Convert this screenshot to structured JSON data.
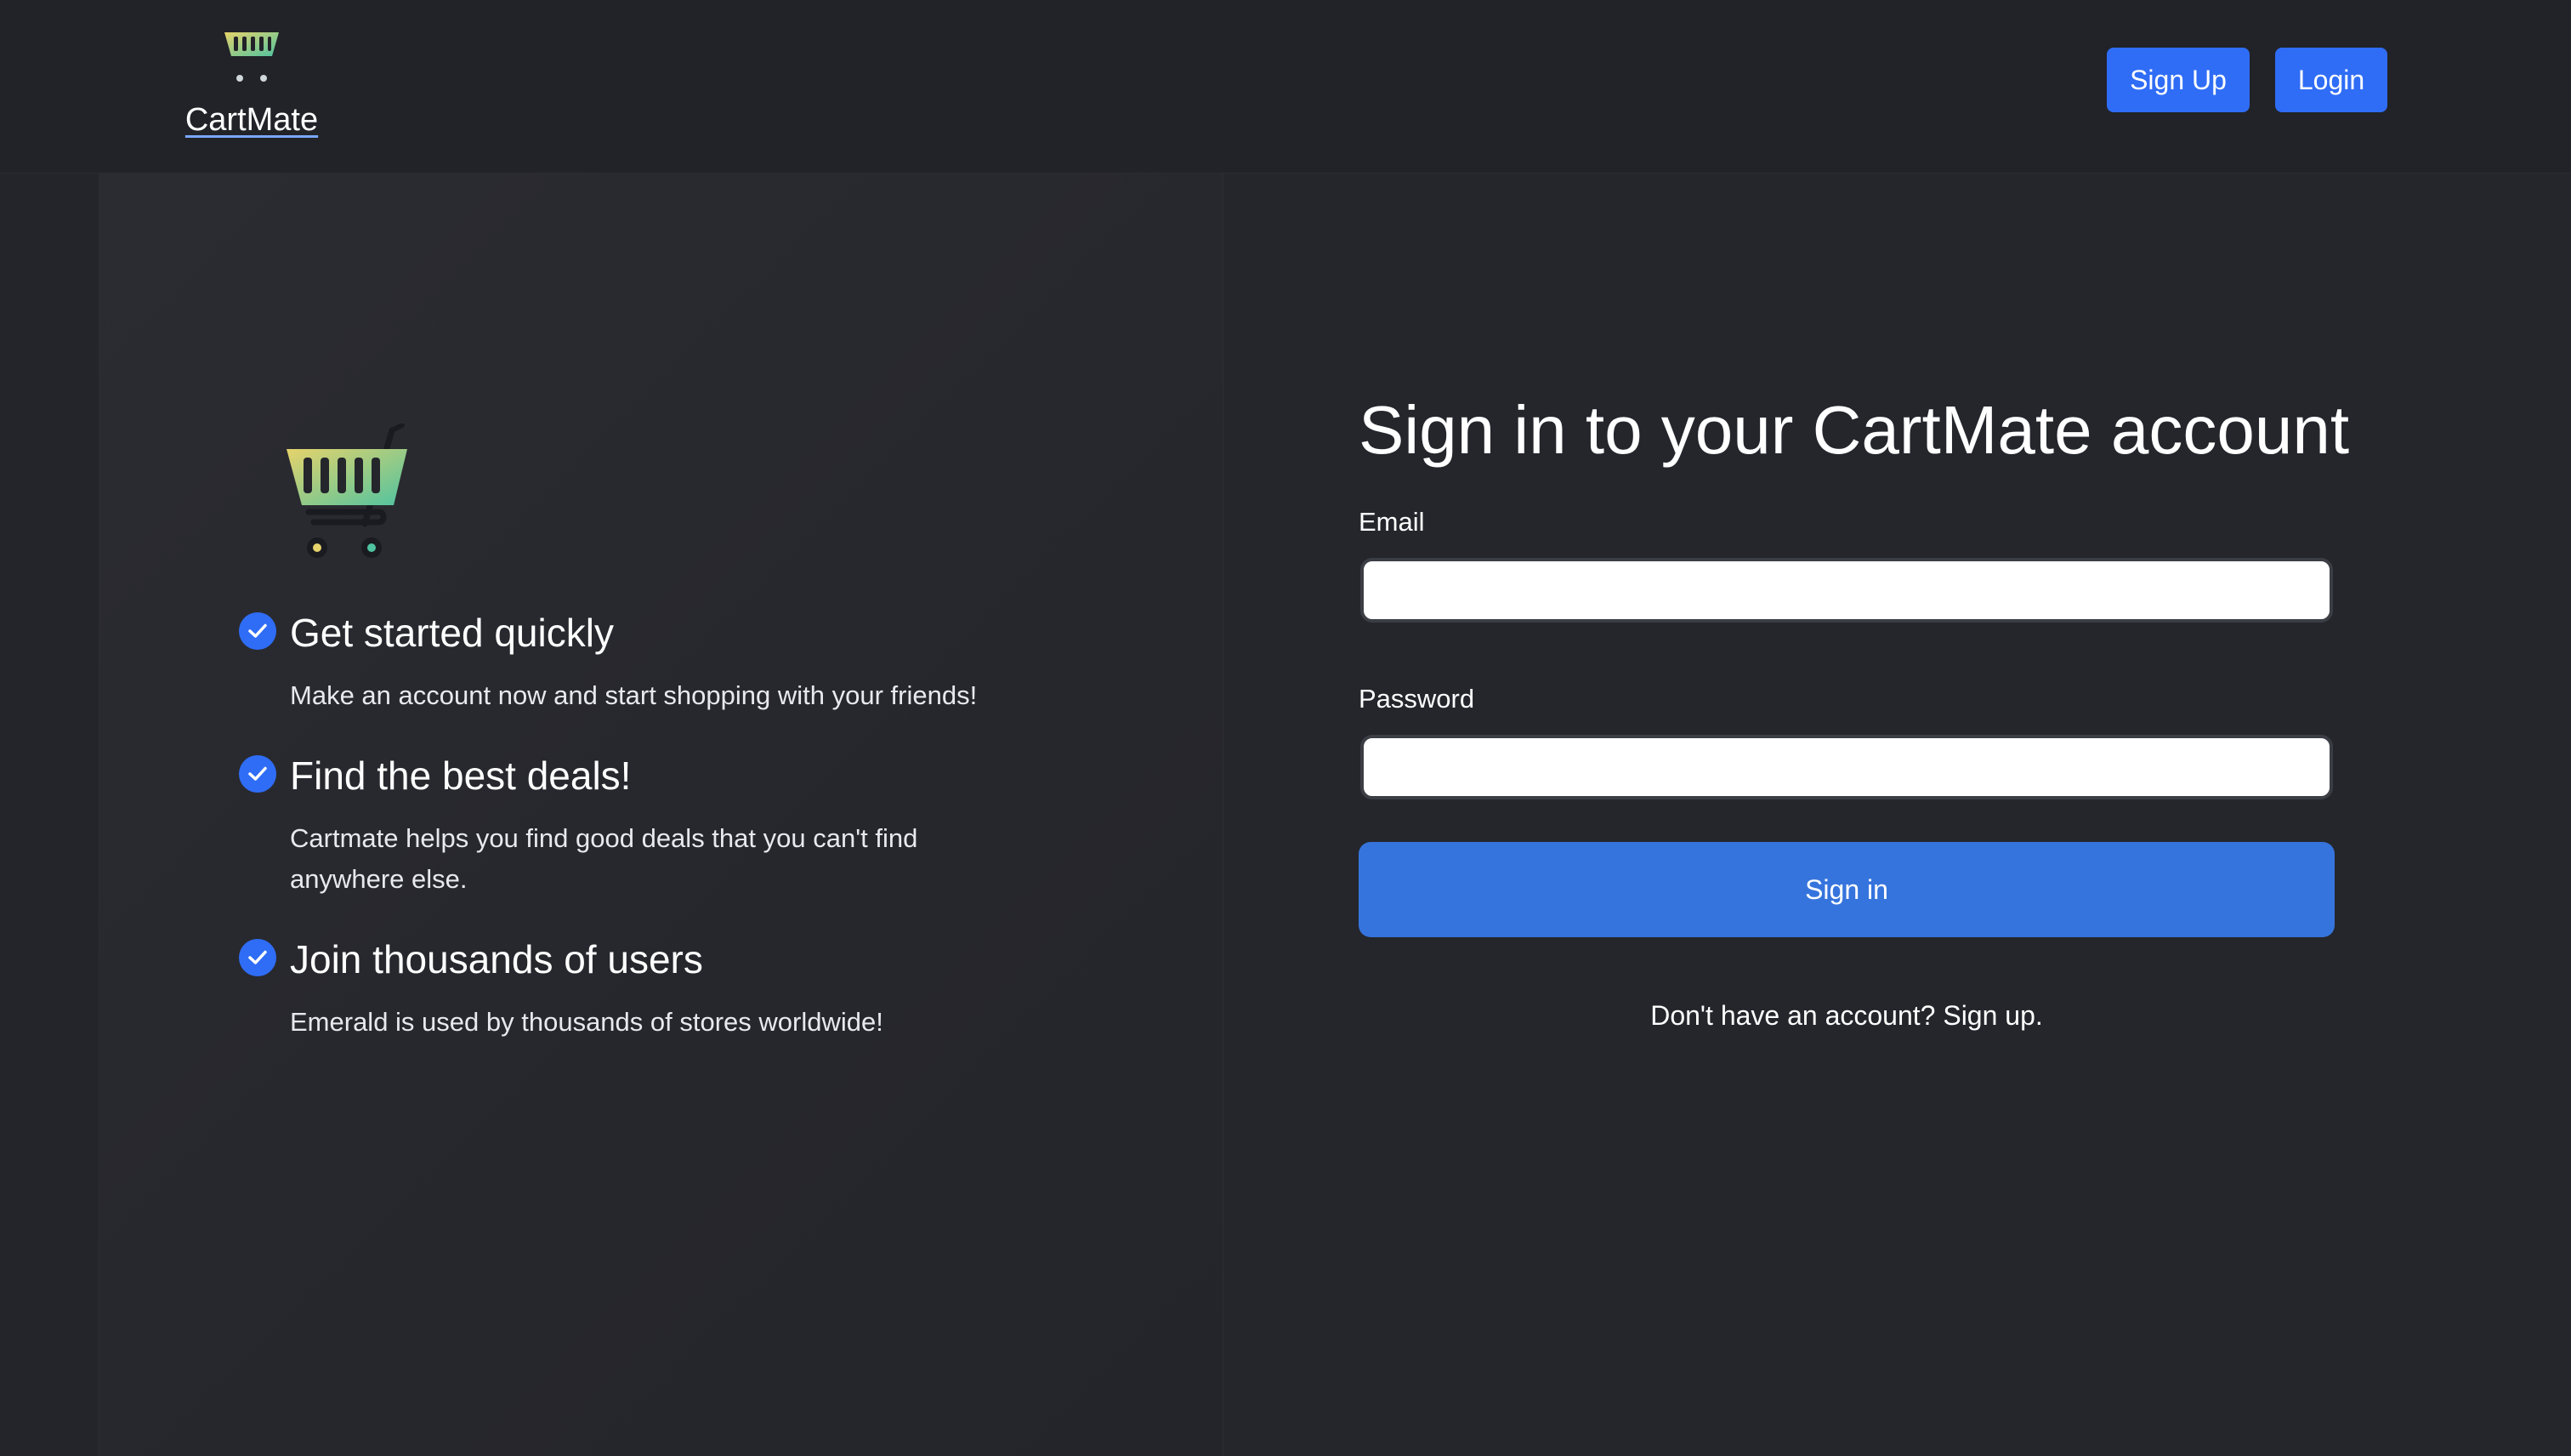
{
  "brand": {
    "name": "CartMate",
    "colors": {
      "basket_top": "#e6d36b",
      "basket_bottom": "#4fc3a0"
    }
  },
  "nav": {
    "signup_label": "Sign Up",
    "login_label": "Login",
    "accent_color": "#2f6df6"
  },
  "features": [
    {
      "title": "Get started quickly",
      "description": "Make an account now and start shopping with your friends!"
    },
    {
      "title": "Find the best deals!",
      "description": "Cartmate helps you find good deals that you can't find anywhere else."
    },
    {
      "title": "Join thousands of users",
      "description": "Emerald is used by thousands of stores worldwide!"
    }
  ],
  "signin": {
    "title": "Sign in to your CartMate account",
    "email_label": "Email",
    "email_value": "",
    "password_label": "Password",
    "password_value": "",
    "submit_label": "Sign in",
    "signup_prompt": "Don't have an account? Sign up."
  }
}
